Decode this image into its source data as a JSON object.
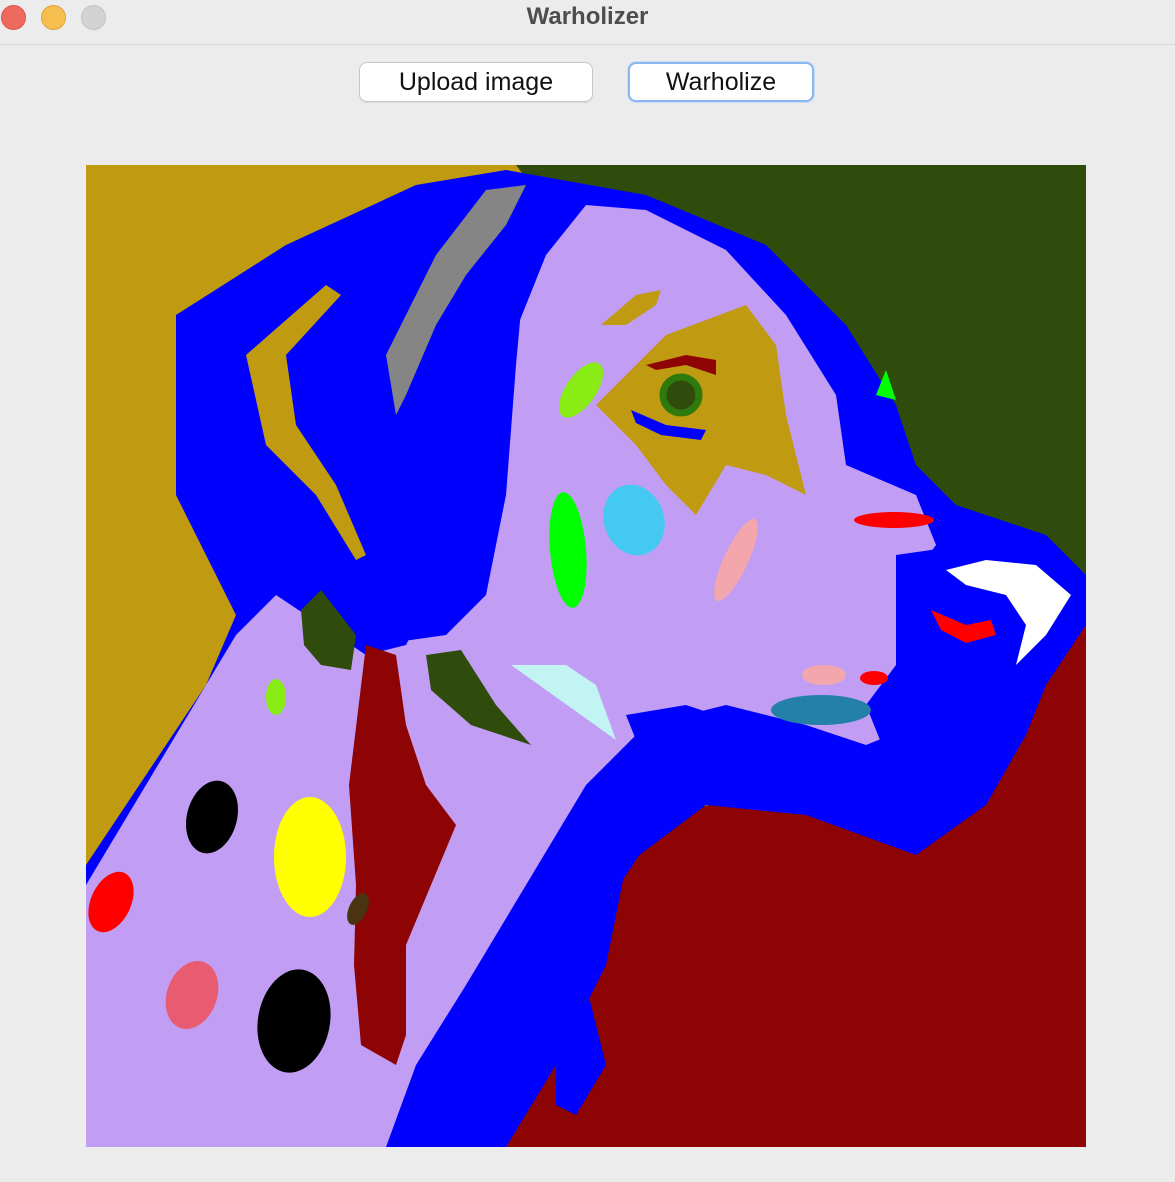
{
  "window": {
    "title": "Warholizer"
  },
  "toolbar": {
    "upload_label": "Upload image",
    "warholize_label": "Warholize"
  },
  "image": {
    "subject": "dalmatian",
    "palette": {
      "ochre": "#c09a10",
      "dark_green": "#2f4c0c",
      "crimson": "#8e0303",
      "lavender": "#c19ef4",
      "blue": "#0000ff",
      "gray": "#858585",
      "light_green": "#00ff00",
      "lime": "#89ec14",
      "sky": "#44caf2",
      "pink": "#f3a7ad",
      "teal": "#2580a8",
      "pale_cyan": "#c1f4f3",
      "red": "#ff0000",
      "yellow": "#ffff00",
      "black": "#000000",
      "rose": "#e95b71",
      "brown": "#4a3310",
      "white": "#ffffff"
    }
  }
}
